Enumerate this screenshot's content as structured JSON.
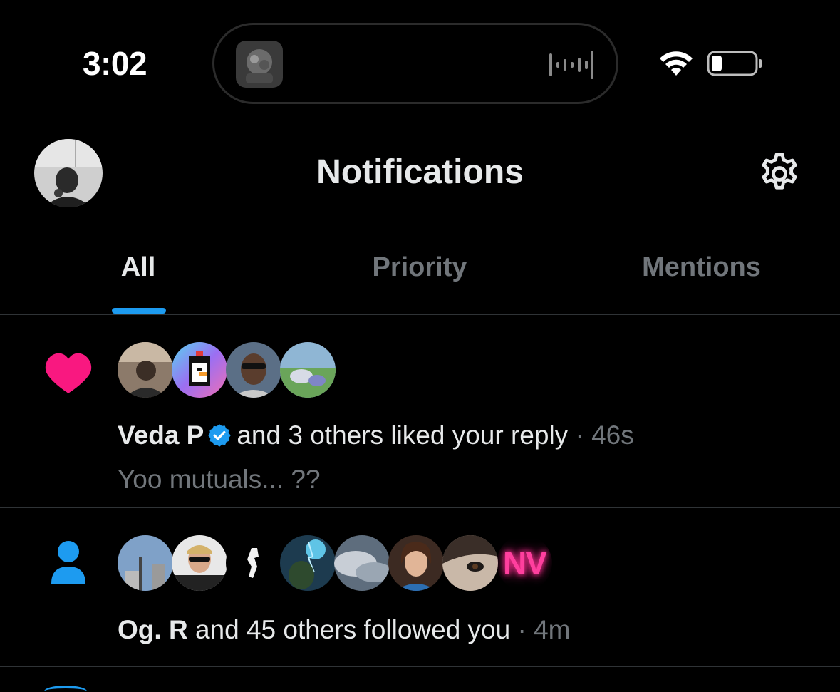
{
  "status_bar": {
    "time": "3:02",
    "battery_icon": "battery-icon",
    "wifi_icon": "wifi-icon"
  },
  "header": {
    "title": "Notifications",
    "settings_icon": "gear-icon"
  },
  "tabs": [
    {
      "label": "All",
      "active": true
    },
    {
      "label": "Priority",
      "active": false
    },
    {
      "label": "Mentions",
      "active": false
    }
  ],
  "notifications": [
    {
      "type": "like",
      "icon": "heart-icon",
      "icon_color": "#f91880",
      "avatar_count": 4,
      "actor": "Veda P",
      "verified": true,
      "text": "and 3 others liked your reply",
      "separator": "·",
      "time": "46s",
      "preview": "Yoo mutuals... ??"
    },
    {
      "type": "follow",
      "icon": "person-icon",
      "icon_color": "#1d9bf0",
      "avatar_count": 8,
      "avatar_badge_text": "NV",
      "actor": "Og. R",
      "verified": false,
      "text": "and 45 others followed you",
      "separator": "·",
      "time": "4m"
    }
  ],
  "colors": {
    "accent": "#1d9bf0",
    "like": "#f91880",
    "background": "#000000",
    "muted": "#71767b"
  }
}
